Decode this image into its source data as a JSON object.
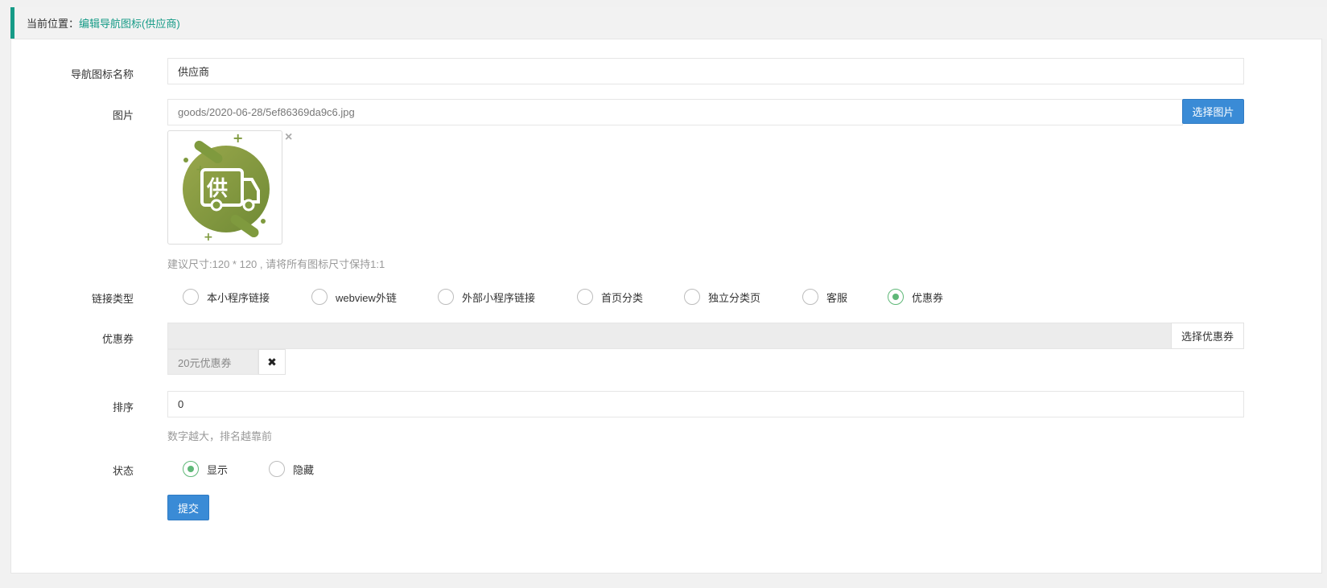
{
  "breadcrumb": {
    "label": "当前位置：",
    "current": "编辑导航图标(供应商)"
  },
  "form": {
    "name_label": "导航图标名称",
    "name_value": "供应商",
    "image_label": "图片",
    "image_path": "goods/2020-06-28/5ef86369da9c6.jpg",
    "select_image_button": "选择图片",
    "image_remove": "×",
    "image_thumb_char": "供",
    "image_hint": "建议尺寸:120 * 120 , 请将所有图标尺寸保持1:1",
    "link_type_label": "链接类型",
    "link_types": [
      "本小程序链接",
      "webview外链",
      "外部小程序链接",
      "首页分类",
      "独立分类页",
      "客服",
      "优惠券"
    ],
    "link_type_selected": "优惠券",
    "coupon_label": "优惠券",
    "select_coupon_button": "选择优惠券",
    "coupon_tag": "20元优惠券",
    "coupon_tag_remove": "✖",
    "sort_label": "排序",
    "sort_value": "0",
    "sort_hint": "数字越大，排名越靠前",
    "status_label": "状态",
    "status_options": [
      "显示",
      "隐藏"
    ],
    "status_selected": "显示",
    "submit_button": "提交"
  },
  "colors": {
    "accent": "#169b87",
    "primary": "#3a8bd6",
    "radio_checked": "#5fb878"
  }
}
